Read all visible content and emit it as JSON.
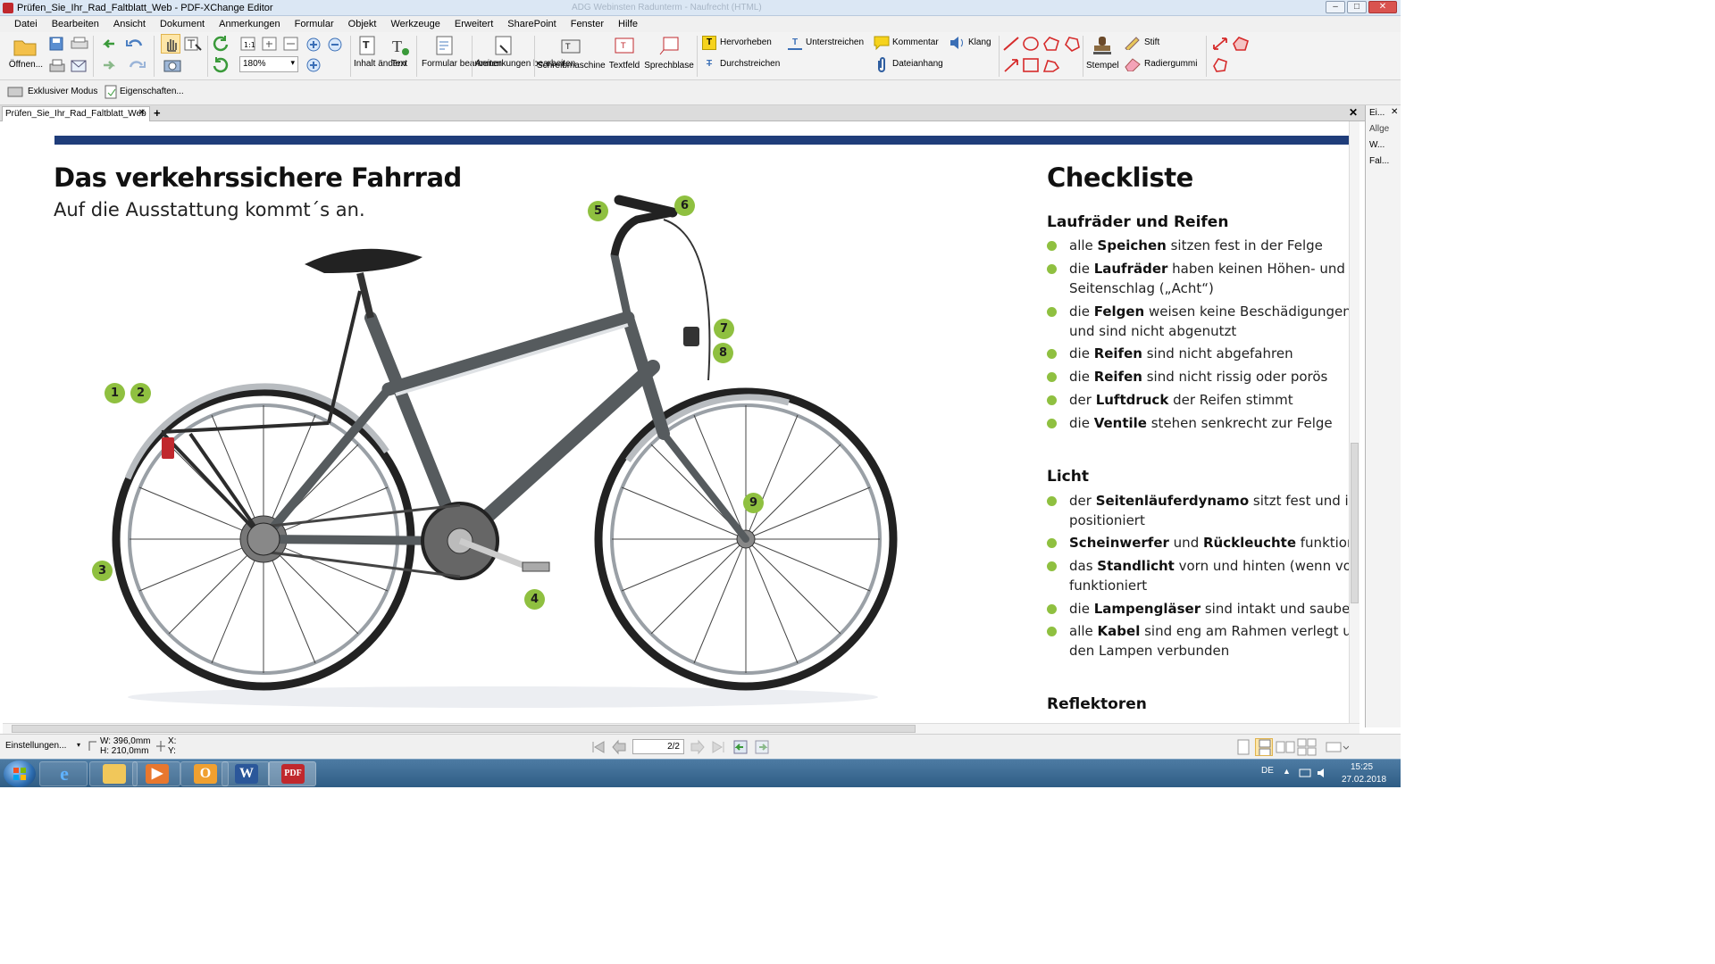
{
  "window": {
    "title": "Prüfen_Sie_Ihr_Rad_Faltblatt_Web - PDF-XChange Editor",
    "ghost_title": "ADG Webinsten Radunterm - Naufrecht (HTML)"
  },
  "menu": [
    "Datei",
    "Bearbeiten",
    "Ansicht",
    "Dokument",
    "Anmerkungen",
    "Formular",
    "Objekt",
    "Werkzeuge",
    "Erweitert",
    "SharePoint",
    "Fenster",
    "Hilfe"
  ],
  "ribbon": {
    "open_label": "Öffnen...",
    "zoom_value": "180%",
    "inhalt_label": "Inhalt ändern",
    "text_label": "Text",
    "formular_label": "Formular bearbeiten",
    "anmerkungen_label": "Anmerkungen bearbeiten",
    "schreibmaschine_label": "Schreibmaschine",
    "textfeld_label": "Textfeld",
    "sprechblase_label": "Sprechblase",
    "hervorheben_label": "Hervorheben",
    "unterstreichen_label": "Unterstreichen",
    "durchstreichen_label": "Durchstreichen",
    "kommentar_label": "Kommentar",
    "dateianhang_label": "Dateianhang",
    "klang_label": "Klang",
    "stempel_label": "Stempel",
    "stift_label": "Stift",
    "radiergummi_label": "Radiergummi"
  },
  "toolbar2": {
    "exclusive_label": "Exklusiver Modus",
    "properties_label": "Eigenschaften..."
  },
  "tabs": {
    "doc_tab": "Prüfen_Sie_Ihr_Rad_Faltblatt_Web",
    "add": "+"
  },
  "right_panel": {
    "header": "Ei...",
    "group": "Allge",
    "item1": "W...",
    "item2": "Fal..."
  },
  "document": {
    "title": "Das verkehrssichere Fahrrad",
    "subtitle": "Auf die Ausstattung kommt´s an.",
    "checklist_title": "Checkliste",
    "markers": [
      "1",
      "2",
      "3",
      "4",
      "5",
      "6",
      "7",
      "8",
      "9"
    ],
    "sections": [
      {
        "heading": "Laufräder und Reifen",
        "items": [
          {
            "pre": "alle ",
            "bold": "Speichen",
            "post": " sitzen fest in der Felge",
            "line2": ""
          },
          {
            "pre": "die ",
            "bold": "Laufräder",
            "post": " haben keinen Höhen- und",
            "line2": "Seitenschlag („Acht“)"
          },
          {
            "pre": "die ",
            "bold": "Felgen",
            "post": " weisen keine Beschädigungen",
            "line2": "und sind nicht abgenutzt"
          },
          {
            "pre": "die ",
            "bold": "Reifen",
            "post": " sind nicht abgefahren",
            "line2": ""
          },
          {
            "pre": "die ",
            "bold": "Reifen",
            "post": " sind nicht rissig oder porös",
            "line2": ""
          },
          {
            "pre": "der ",
            "bold": "Luftdruck",
            "post": " der Reifen stimmt",
            "line2": ""
          },
          {
            "pre": "die ",
            "bold": "Ventile",
            "post": " stehen senkrecht zur Felge",
            "line2": ""
          }
        ]
      },
      {
        "heading": "Licht",
        "items": [
          {
            "pre": "der ",
            "bold": "Seitenläuferdynamo",
            "post": " sitzt fest und ist",
            "line2": "positioniert"
          },
          {
            "pre": "",
            "bold": "Scheinwerfer",
            "post": " und ",
            "bold2": "Rückleuchte",
            "post2": " funktioni",
            "line2": ""
          },
          {
            "pre": "das ",
            "bold": "Standlicht",
            "post": " vorn und hinten (wenn vorh",
            "line2": "funktioniert"
          },
          {
            "pre": "die ",
            "bold": "Lampengläser",
            "post": " sind intakt und sauber",
            "line2": ""
          },
          {
            "pre": "alle ",
            "bold": "Kabel",
            "post": " sind eng am Rahmen verlegt u",
            "line2": "den Lampen verbunden"
          }
        ]
      },
      {
        "heading": "Reflektoren",
        "items": []
      }
    ]
  },
  "status": {
    "settings_label": "Einstellungen...",
    "width_label": "W: 396,0mm",
    "height_label": "H: 210,0mm",
    "x_label": "X:",
    "y_label": "Y:",
    "page_value": "2/2"
  },
  "taskbar": {
    "lang": "DE",
    "time": "15:25",
    "date": "27.02.2018"
  },
  "colors": {
    "accent_blue": "#1f3d7a",
    "marker_green": "#8fc040",
    "pdf_red": "#c0282d"
  }
}
